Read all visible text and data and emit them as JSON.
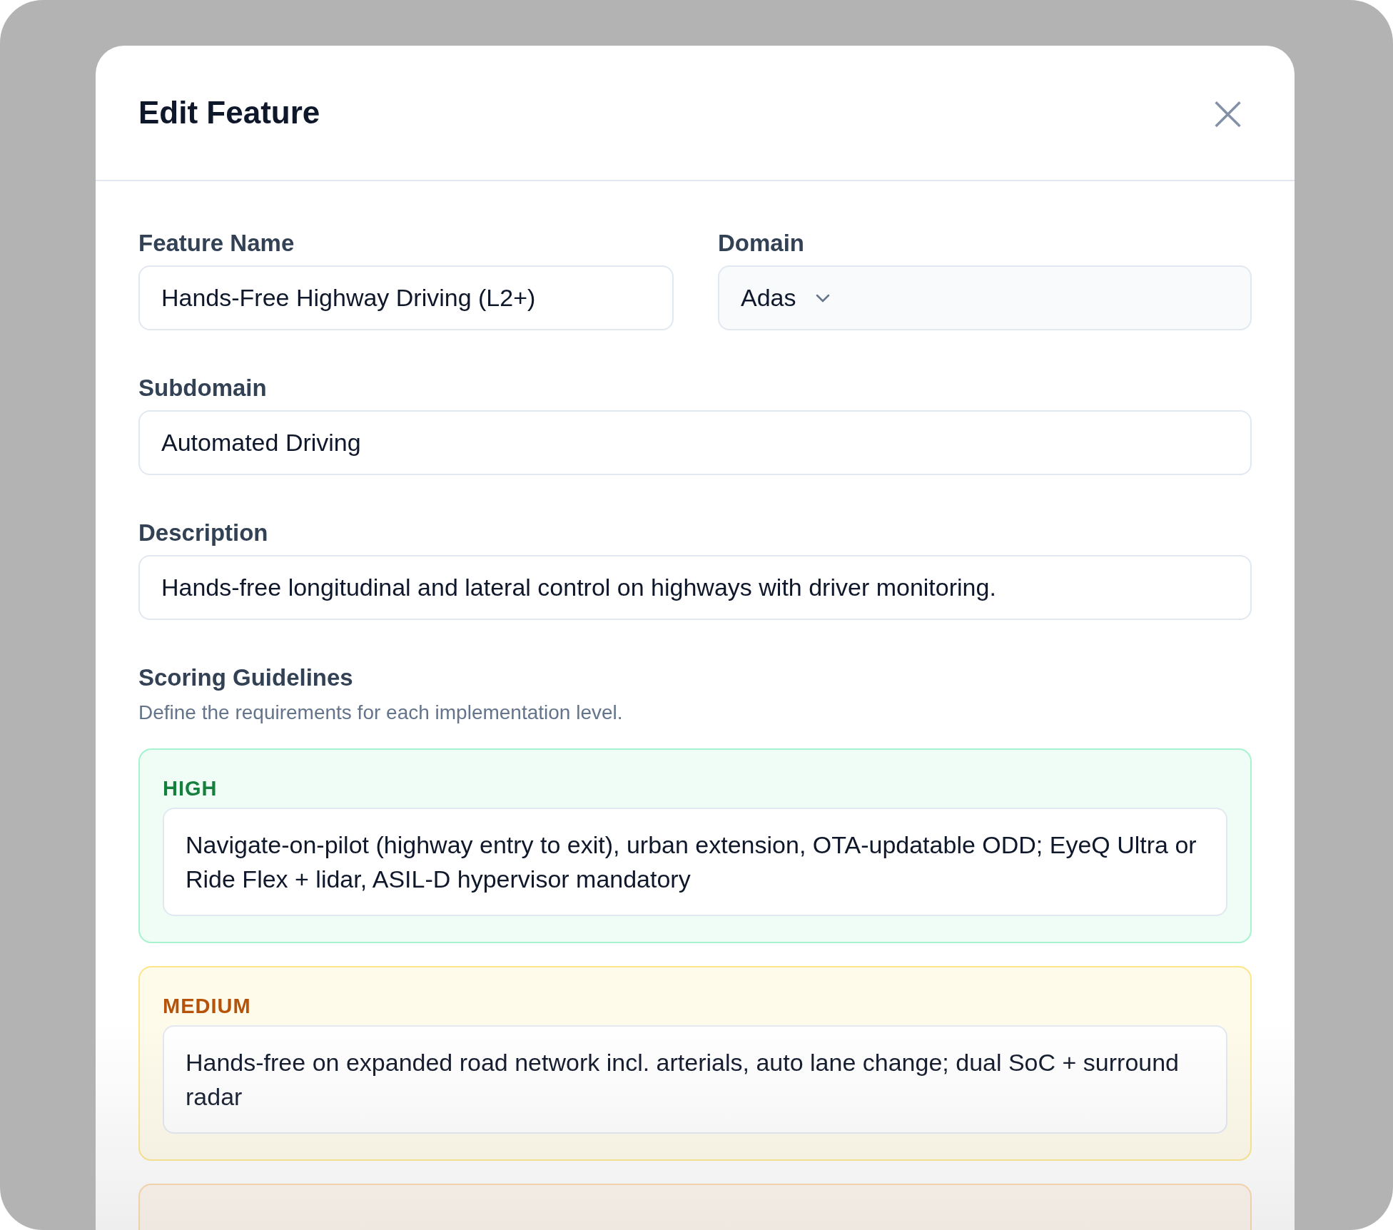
{
  "dialog": {
    "title": "Edit Feature",
    "close_icon": "×"
  },
  "fields": [
    {
      "kind": "text",
      "label": "Feature Name",
      "value": "Hands-Free Highway Driving (L2+)"
    },
    {
      "kind": "select",
      "label": "Domain",
      "value": "Adas"
    },
    {
      "kind": "text",
      "label": "Subdomain",
      "value": "Automated Driving"
    },
    {
      "kind": "text",
      "label": "Description",
      "value": "Hands-free longitudinal and lateral control on highways with driver monitoring."
    }
  ],
  "scoring": {
    "title": "Scoring Guidelines",
    "subtitle": "Define the requirements for each implementation level.",
    "levels": [
      {
        "kind": "high",
        "label": "HIGH",
        "text": "Navigate-on-pilot (highway entry to exit), urban extension, OTA-updatable ODD; EyeQ Ultra or Ride Flex + lidar, ASIL-D hypervisor mandatory"
      },
      {
        "kind": "medium",
        "label": "MEDIUM",
        "text": "Hands-free on expanded road network incl. arterials, auto lane change; dual SoC + surround radar"
      },
      {
        "kind": "low"
      }
    ]
  }
}
